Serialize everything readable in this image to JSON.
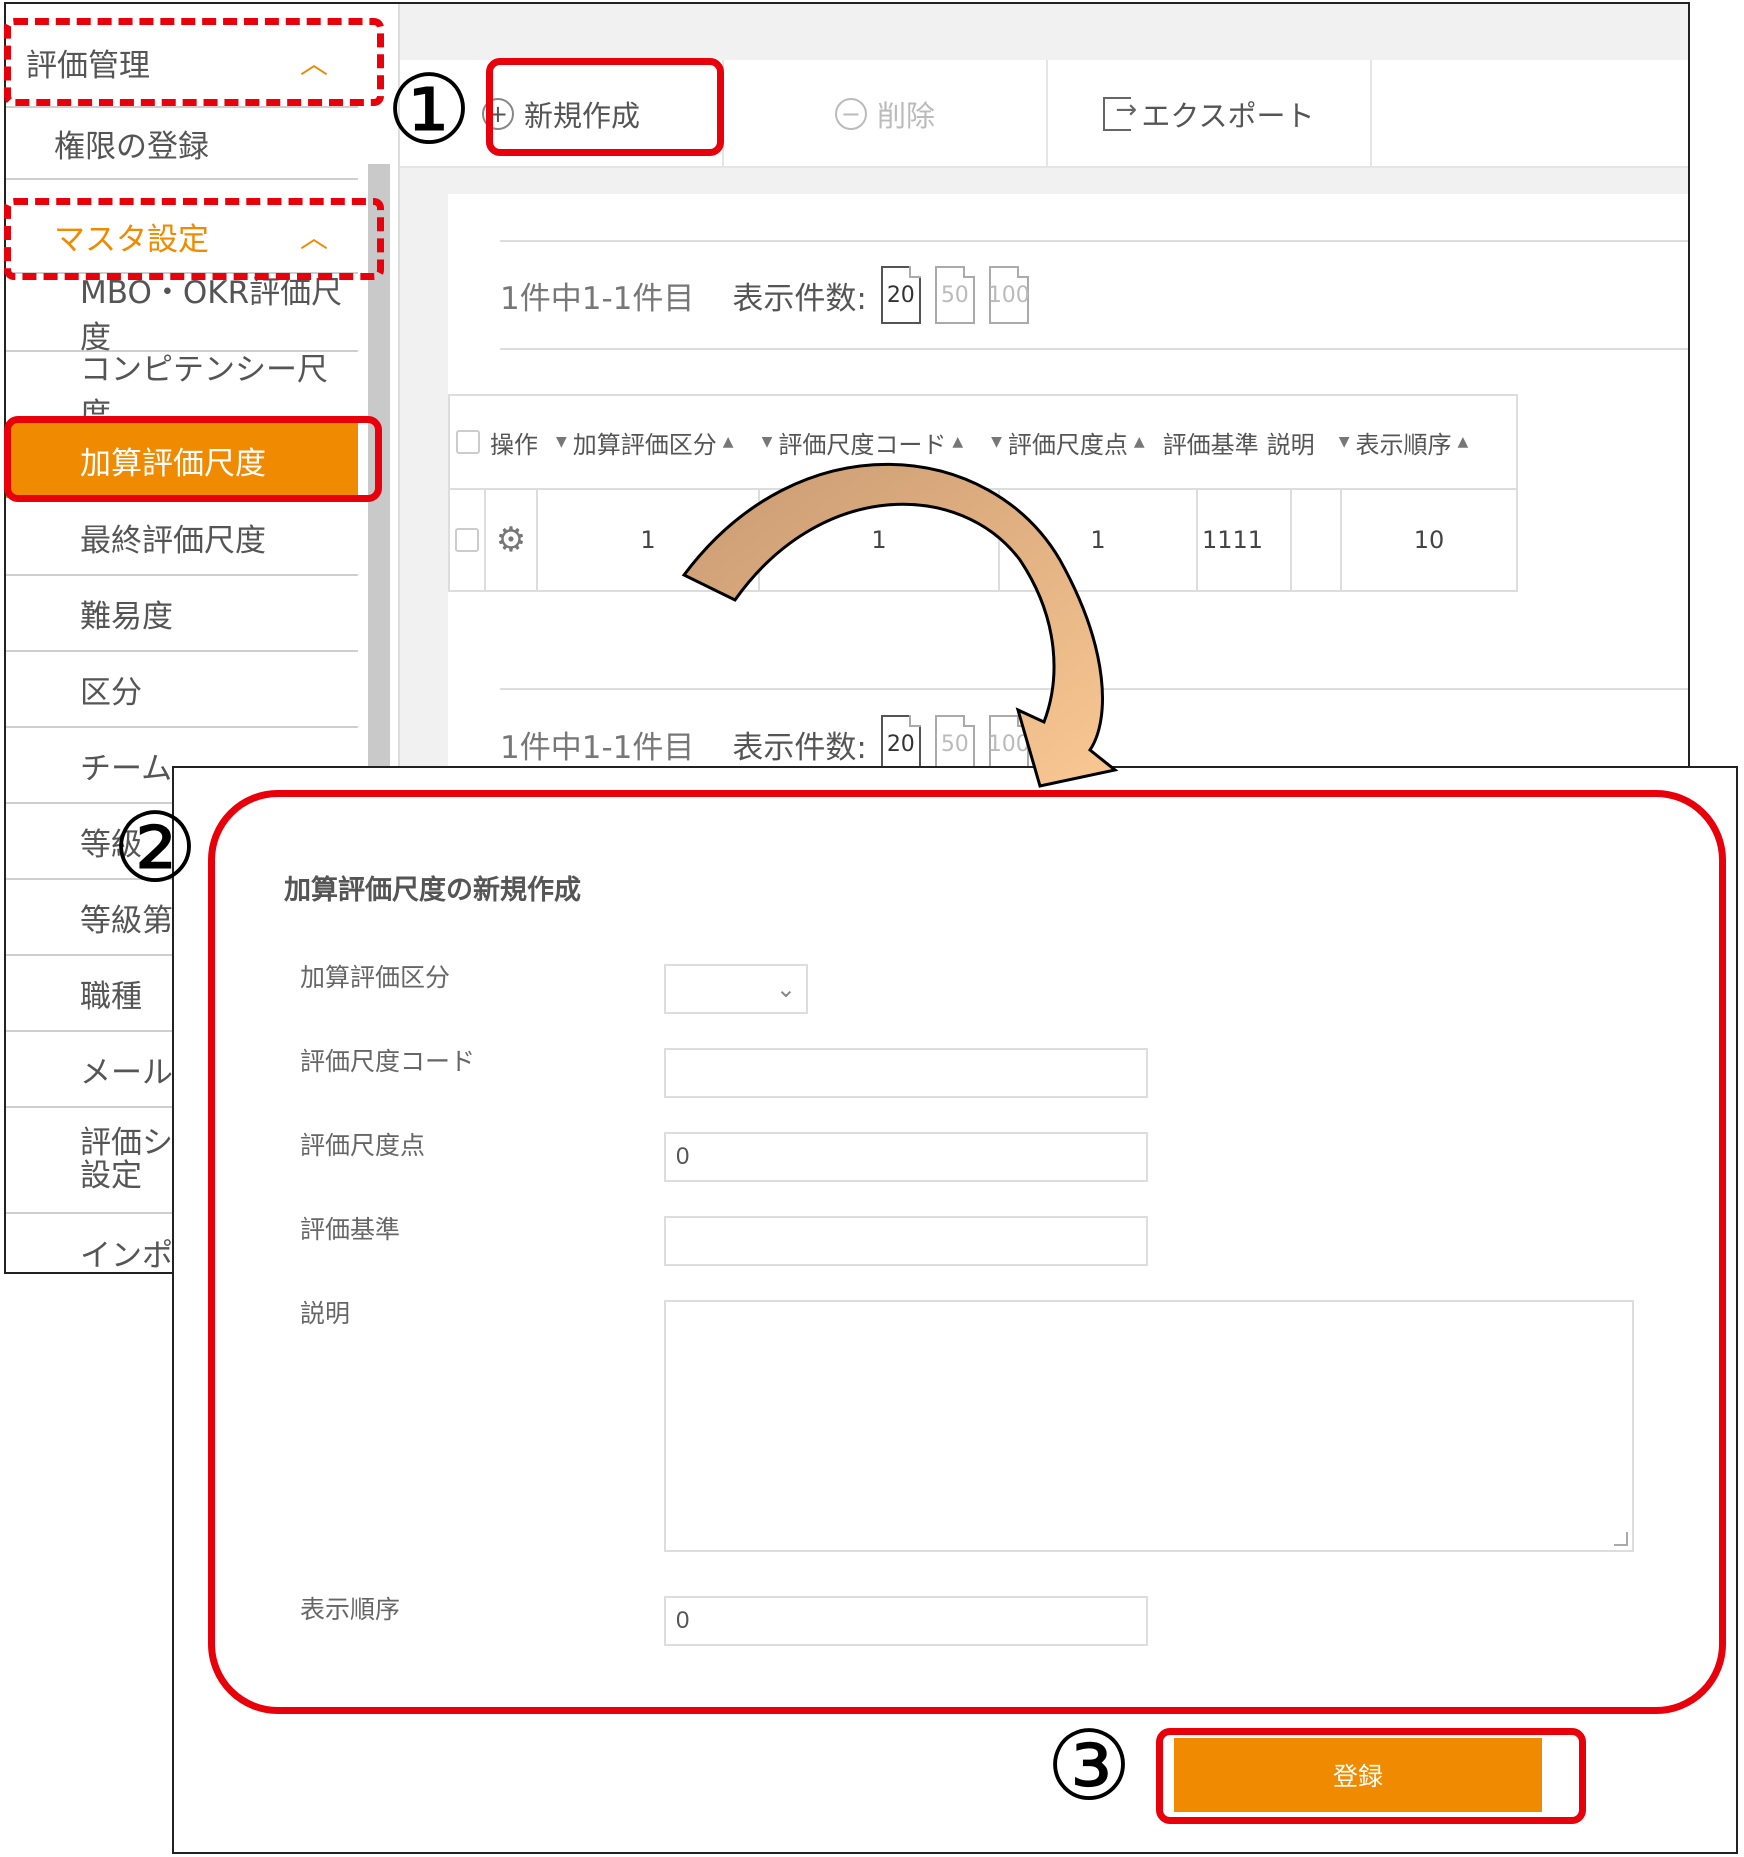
{
  "sidebar": {
    "items": [
      {
        "label": "評価管理",
        "kind": "category"
      },
      {
        "label": "権限の登録",
        "kind": "item"
      },
      {
        "label": "マスタ設定",
        "kind": "category"
      },
      {
        "label": "MBO・OKR評価尺度",
        "kind": "sub"
      },
      {
        "label": "コンピテンシー尺度",
        "kind": "sub"
      },
      {
        "label": "加算評価尺度",
        "kind": "sub",
        "active": true
      },
      {
        "label": "最終評価尺度",
        "kind": "sub"
      },
      {
        "label": "難易度",
        "kind": "sub"
      },
      {
        "label": "区分",
        "kind": "sub"
      },
      {
        "label": "チーム",
        "kind": "sub"
      },
      {
        "label": "等級",
        "kind": "sub"
      },
      {
        "label": "等級第二",
        "kind": "sub"
      },
      {
        "label": "職種",
        "kind": "sub"
      },
      {
        "label": "メール配",
        "kind": "sub"
      },
      {
        "label": "評価シー",
        "label2": "設定",
        "kind": "sub"
      },
      {
        "label": "インポー",
        "kind": "sub"
      }
    ]
  },
  "toolbar": {
    "new_label": "新規作成",
    "delete_label": "削除",
    "export_label": "エクスポート"
  },
  "pager": {
    "count_text": "1件中1-1件目",
    "per_page_label": "表示件数:",
    "sizes": [
      "20",
      "50",
      "100"
    ],
    "current_size": "20"
  },
  "grid": {
    "headers": [
      "操作",
      "加算評価区分",
      "評価尺度コード",
      "評価尺度点",
      "評価基準",
      "説明",
      "表示順序"
    ],
    "rows": [
      {
        "category": "1",
        "code": "1",
        "points": "1",
        "criteria": "1111",
        "description": "",
        "order": "10"
      }
    ]
  },
  "dialog": {
    "title": "加算評価尺度の新規作成",
    "fields": {
      "category_label": "加算評価区分",
      "code_label": "評価尺度コード",
      "points_label": "評価尺度点",
      "points_value": "0",
      "criteria_label": "評価基準",
      "description_label": "説明",
      "order_label": "表示順序",
      "order_value": "0"
    },
    "submit_label": "登録"
  },
  "annotations": {
    "step1": "①",
    "step2": "②",
    "step3": "③",
    "highlight_color": "#e8000b",
    "arrow_color": "#f5c99a"
  },
  "colors": {
    "accent": "#f08a00"
  },
  "icons": {
    "collapse": "chevron-up-icon",
    "add": "plus-circle-icon",
    "delete": "minus-circle-icon",
    "export": "export-icon",
    "settings": "gear-icon",
    "dropdown": "chevron-down-icon"
  }
}
